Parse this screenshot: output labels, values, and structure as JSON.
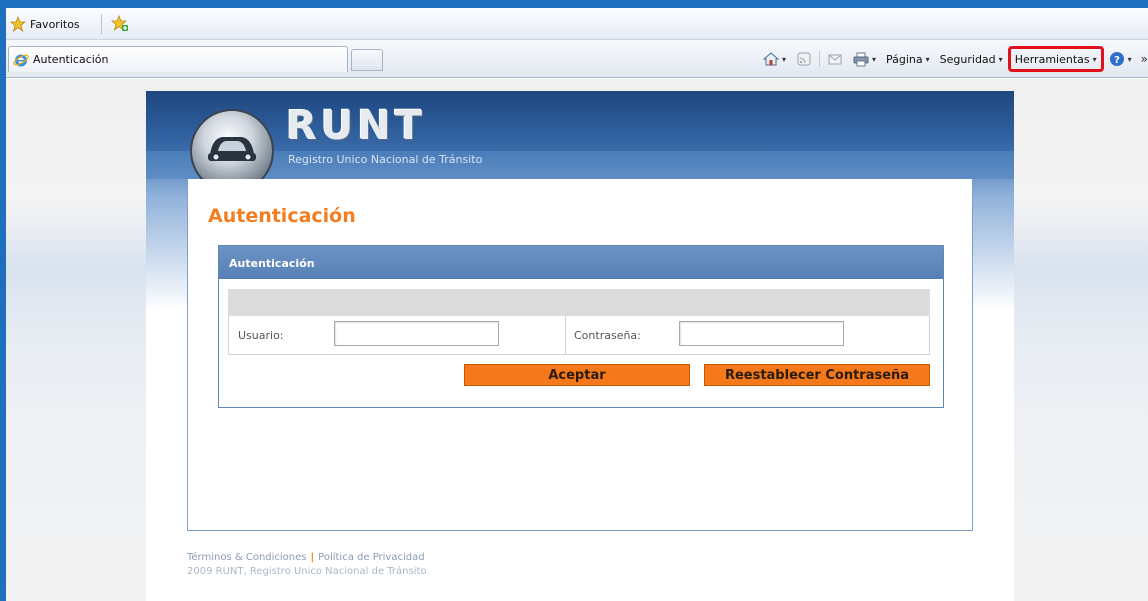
{
  "browser": {
    "favorites_label": "Favoritos",
    "tab_title": "Autenticación",
    "menu": {
      "pagina": "Página",
      "seguridad": "Seguridad",
      "herramientas": "Herramientas"
    },
    "overflow_glyph": "»",
    "dropdown_glyph": "▾"
  },
  "site": {
    "brand": "RUNT",
    "brand_subtitle": "Registro Unico Nacional de Tránsito",
    "page_title": "Autenticación",
    "panel": {
      "header": "Autenticación",
      "user_label": "Usuario:",
      "user_value": "",
      "password_label": "Contraseña:",
      "password_value": "",
      "accept_button": "Aceptar",
      "reset_button": "Reestablecer Contraseña"
    },
    "footer": {
      "terms": "Términos & Condiciones",
      "privacy": "Política de Privacidad",
      "copyright": "2009 RUNT, Registro Unico Nacional de Tránsito"
    }
  },
  "colors": {
    "accent_orange": "#f37d21",
    "brand_blue": "#2e5e9c",
    "highlight_red": "#e2101a"
  }
}
